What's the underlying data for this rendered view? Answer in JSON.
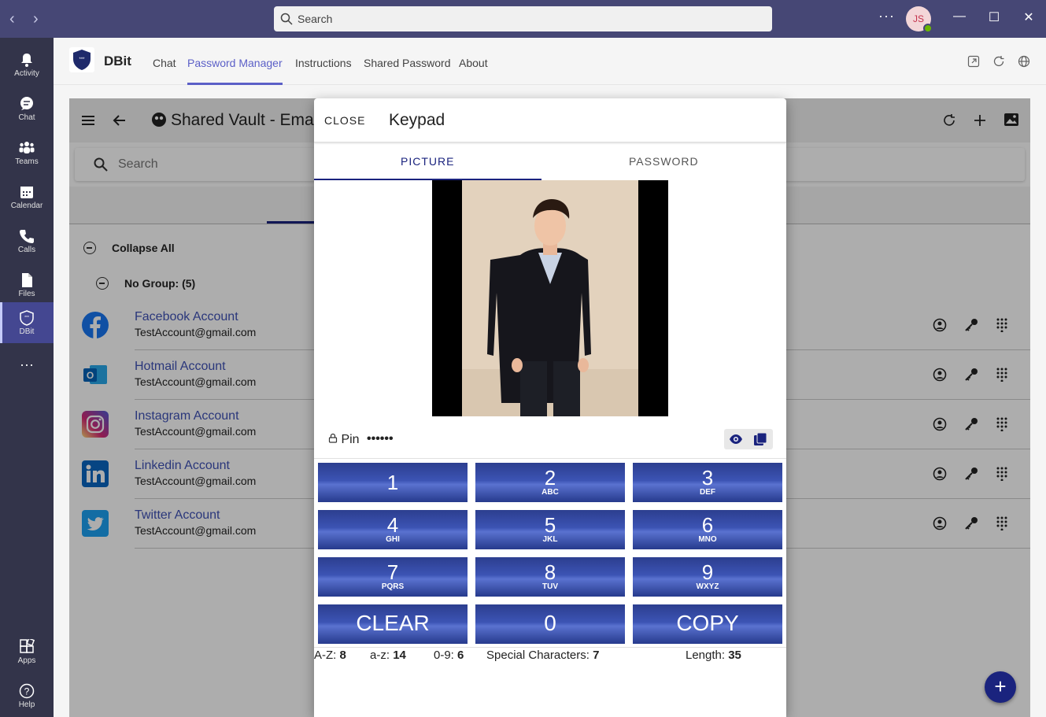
{
  "titlebar": {
    "search_placeholder": "Search",
    "more": "···",
    "avatar_initials": "JS"
  },
  "rail": {
    "items": [
      {
        "label": "Activity"
      },
      {
        "label": "Chat"
      },
      {
        "label": "Teams"
      },
      {
        "label": "Calendar"
      },
      {
        "label": "Calls"
      },
      {
        "label": "Files"
      },
      {
        "label": "DBit"
      },
      {
        "label": "Apps"
      },
      {
        "label": "Help"
      }
    ],
    "more": "···"
  },
  "app": {
    "name": "DBit",
    "tabs": [
      {
        "label": "Chat"
      },
      {
        "label": "Password Manager"
      },
      {
        "label": "Instructions"
      },
      {
        "label": "Shared Password"
      },
      {
        "label": "About"
      }
    ]
  },
  "vault": {
    "title": "Shared Vault - Emai",
    "search_placeholder": "Search",
    "collapse_all": "Collapse All",
    "group_label": "No Group: (5)",
    "accounts": [
      {
        "name": "Facebook Account",
        "email": "TestAccount@gmail.com",
        "color": "#1877f2"
      },
      {
        "name": "Hotmail Account",
        "email": "TestAccount@gmail.com",
        "color": "#0364b8"
      },
      {
        "name": "Instagram Account",
        "email": "TestAccount@gmail.com",
        "color": "#c13584"
      },
      {
        "name": "Linkedin Account",
        "email": "TestAccount@gmail.com",
        "color": "#0a66c2"
      },
      {
        "name": "Twitter Account",
        "email": "TestAccount@gmail.com",
        "color": "#1da1f2"
      }
    ]
  },
  "dialog": {
    "close": "CLOSE",
    "title": "Keypad",
    "tabs": [
      {
        "label": "PICTURE"
      },
      {
        "label": "PASSWORD"
      }
    ],
    "active_tab": "PICTURE",
    "pin_label": "Pin",
    "pin_value": "••••••",
    "keys": [
      {
        "digit": "1",
        "letters": ""
      },
      {
        "digit": "2",
        "letters": "ABC"
      },
      {
        "digit": "3",
        "letters": "DEF"
      },
      {
        "digit": "4",
        "letters": "GHI"
      },
      {
        "digit": "5",
        "letters": "JKL"
      },
      {
        "digit": "6",
        "letters": "MNO"
      },
      {
        "digit": "7",
        "letters": "PQRS"
      },
      {
        "digit": "8",
        "letters": "TUV"
      },
      {
        "digit": "9",
        "letters": "WXYZ"
      },
      {
        "digit": "CLEAR",
        "letters": ""
      },
      {
        "digit": "0",
        "letters": ""
      },
      {
        "digit": "COPY",
        "letters": ""
      }
    ],
    "stats": {
      "upper_label": "A-Z:",
      "upper": "8",
      "lower_label": "a-z:",
      "lower": "14",
      "digits_label": "0-9:",
      "digits": "6",
      "special_label": "Special Characters:",
      "special": "7",
      "length_label": "Length:",
      "length": "35"
    }
  },
  "colors": {
    "titlebar": "#464775",
    "rail": "#33344a",
    "accent": "#5b5fc7",
    "keypad": "#2c3e8f",
    "fab": "#1a237e"
  }
}
